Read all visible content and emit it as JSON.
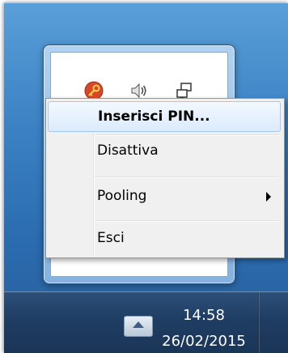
{
  "taskbar": {
    "clock_time": "14:58",
    "clock_date": "26/02/2015",
    "show_hidden_icon": "chevron-up-icon"
  },
  "tray": {
    "icons": [
      "key-app-icon",
      "speaker-icon",
      "network-icon"
    ]
  },
  "context_menu": {
    "items": [
      {
        "label": "Inserisci PIN...",
        "default": true
      },
      {
        "label": "Disattiva"
      },
      {
        "label": "Pooling",
        "has_submenu": true
      },
      {
        "label": "Esci"
      }
    ]
  },
  "colors": {
    "highlight_border": "#a8c8ea",
    "menu_background": "#f0f0f0",
    "taskbar": "#1f3d63"
  }
}
